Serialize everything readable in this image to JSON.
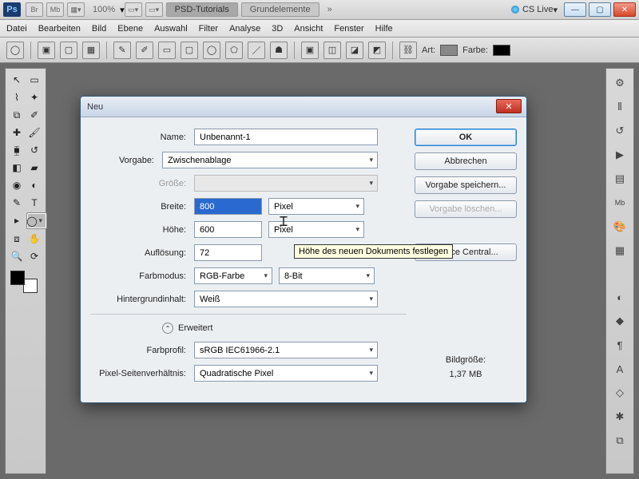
{
  "appbar": {
    "ps": "Ps",
    "br": "Br",
    "mb": "Mb",
    "zoom": "100%",
    "tab_active": "PSD-Tutorials",
    "tab_inactive": "Grundelemente",
    "cslive": "CS Live"
  },
  "menu": {
    "datei": "Datei",
    "bearbeiten": "Bearbeiten",
    "bild": "Bild",
    "ebene": "Ebene",
    "auswahl": "Auswahl",
    "filter": "Filter",
    "analyse": "Analyse",
    "d3d": "3D",
    "ansicht": "Ansicht",
    "fenster": "Fenster",
    "hilfe": "Hilfe"
  },
  "optbar": {
    "art": "Art:",
    "farbe": "Farbe:"
  },
  "dialog": {
    "title": "Neu",
    "name_lbl": "Name:",
    "name_val": "Unbenannt-1",
    "vorgabe_lbl": "Vorgabe:",
    "vorgabe_val": "Zwischenablage",
    "groesse_lbl": "Größe:",
    "breite_lbl": "Breite:",
    "breite_val": "800",
    "breite_unit": "Pixel",
    "hoehe_lbl": "Höhe:",
    "hoehe_val": "600",
    "hoehe_unit": "Pixel",
    "aufl_lbl": "Auflösung:",
    "aufl_val": "72",
    "farbmodus_lbl": "Farbmodus:",
    "farbmodus_val": "RGB-Farbe",
    "farbmodus_bit": "8-Bit",
    "hg_lbl": "Hintergrundinhalt:",
    "hg_val": "Weiß",
    "erweitert": "Erweitert",
    "farbprofil_lbl": "Farbprofil:",
    "farbprofil_val": "sRGB IEC61966-2.1",
    "pixel_sv_lbl": "Pixel-Seitenverhältnis:",
    "pixel_sv_val": "Quadratische Pixel",
    "ok": "OK",
    "abbrechen": "Abbrechen",
    "vorgabe_speichern": "Vorgabe speichern...",
    "vorgabe_loeschen": "Vorgabe löschen...",
    "device_central": "Device Central...",
    "bildgroesse_lbl": "Bildgröße:",
    "bildgroesse_val": "1,37 MB",
    "tooltip": "Höhe des neuen Dokuments festlegen"
  }
}
